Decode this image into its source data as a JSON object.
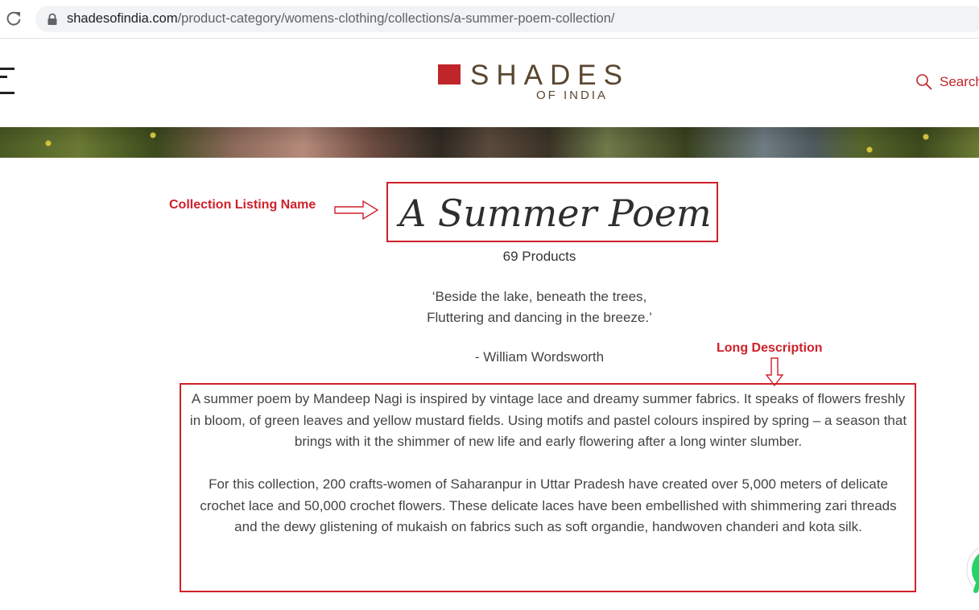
{
  "browser": {
    "url_host": "shadesofindia.com",
    "url_path": "/product-category/womens-clothing/collections/a-summer-poem-collection/"
  },
  "header": {
    "logo_main": "SHADES",
    "logo_sub": "OF INDIA",
    "search_label": "Search",
    "brand_color": "#c0252a"
  },
  "annotations": {
    "title_label": "Collection Listing Name",
    "description_label": "Long Description",
    "color": "#d0202a"
  },
  "collection": {
    "title": "A Summer Poem",
    "product_count": "69 Products",
    "quote_line_1": "‘Beside the lake, beneath the trees,",
    "quote_line_2": "Fluttering and dancing in the breeze.’",
    "quote_author": "- William Wordsworth",
    "description_1": "A summer poem by Mandeep Nagi is inspired by vintage lace and dreamy summer fabrics. It speaks of flowers freshly in bloom, of green leaves and yellow mustard fields. Using motifs and pastel colours inspired by spring – a season that brings with it the shimmer of new life and early flowering after a long winter slumber.",
    "description_2": "For this collection, 200 crafts-women of Saharanpur in Uttar Pradesh have created over 5,000 meters of delicate crochet lace and 50,000 crochet flowers. These delicate laces have been embellished with shimmering zari threads and the dewy glistening of mukaish on fabrics such as soft organdie, handwoven chanderi and kota silk."
  },
  "icons": {
    "reload": "reload-icon",
    "lock": "lock-icon",
    "menu": "menu-icon",
    "search": "search-icon",
    "whatsapp": "whatsapp-icon"
  }
}
